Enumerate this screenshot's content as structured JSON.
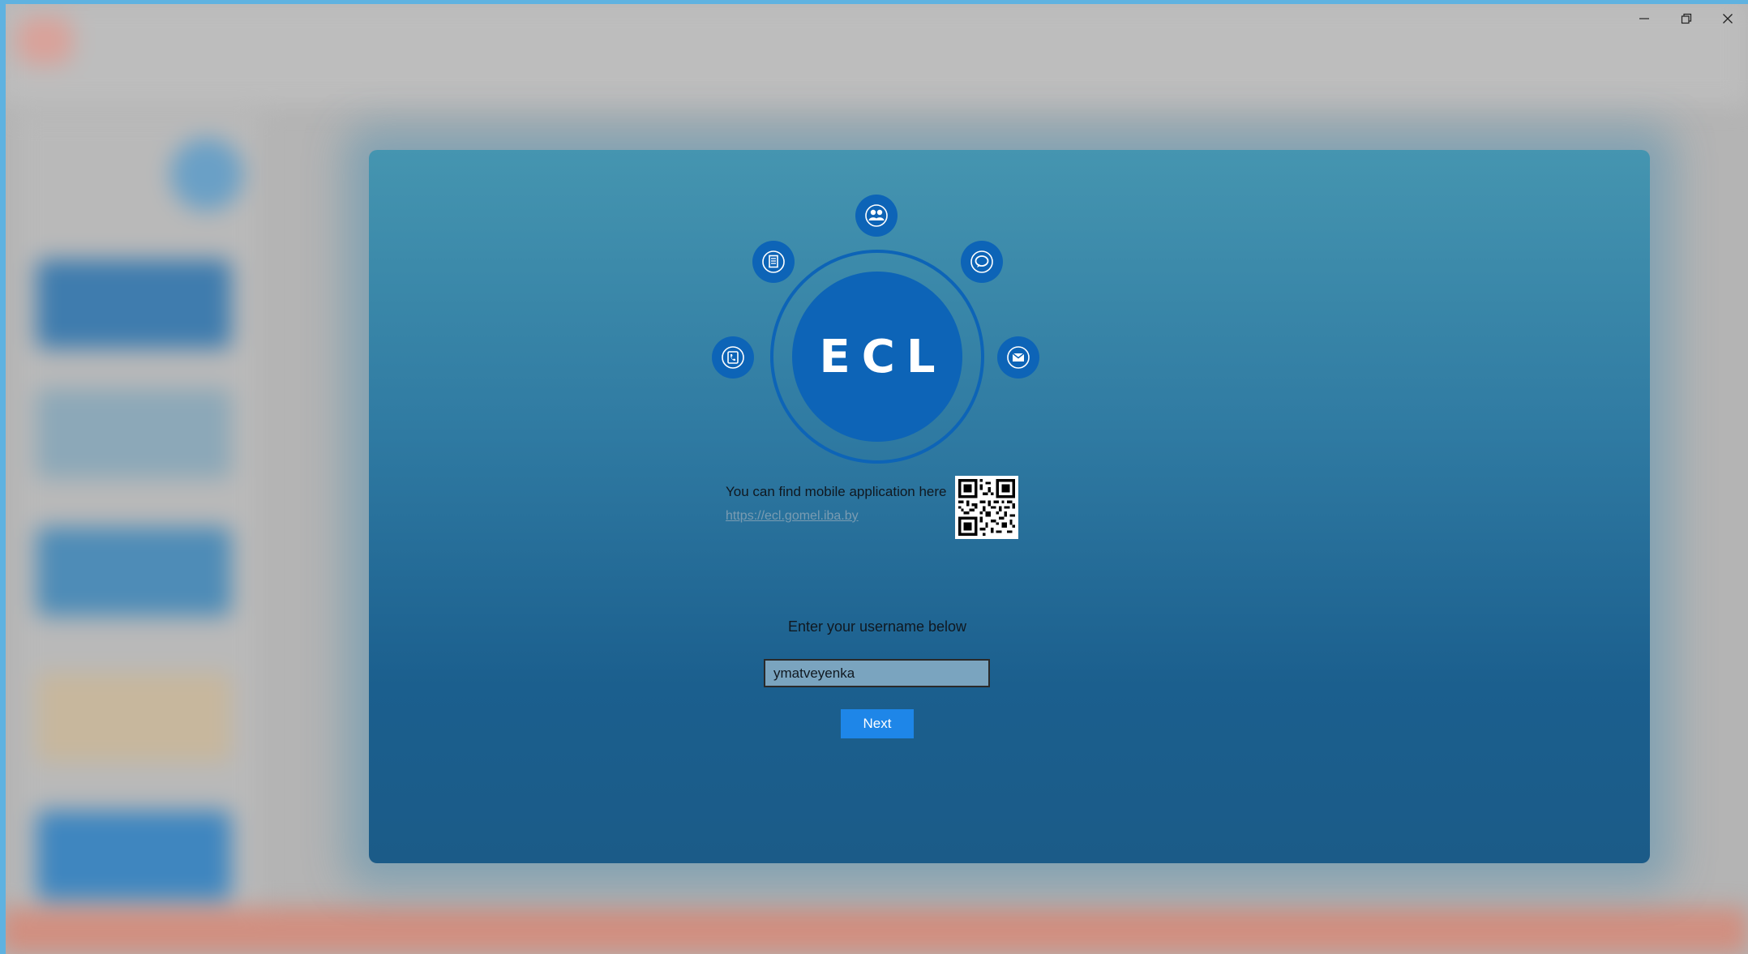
{
  "window": {
    "controls": {
      "minimize_icon": "minimize-icon",
      "restore_icon": "restore-icon",
      "close_icon": "close-icon"
    }
  },
  "logo": {
    "text": "ECL",
    "icons": [
      "users-icon",
      "document-icon",
      "chat-icon",
      "phone-icon",
      "mail-icon"
    ],
    "color": "#0d64b7"
  },
  "mobile_app": {
    "text": "You can find mobile application here",
    "link": "https://ecl.gomel.iba.by",
    "qr_icon": "qr-code-icon"
  },
  "login": {
    "prompt": "Enter your username below",
    "username_value": "ymatveyenka",
    "next_label": "Next",
    "button_color": "#1e86e8"
  }
}
